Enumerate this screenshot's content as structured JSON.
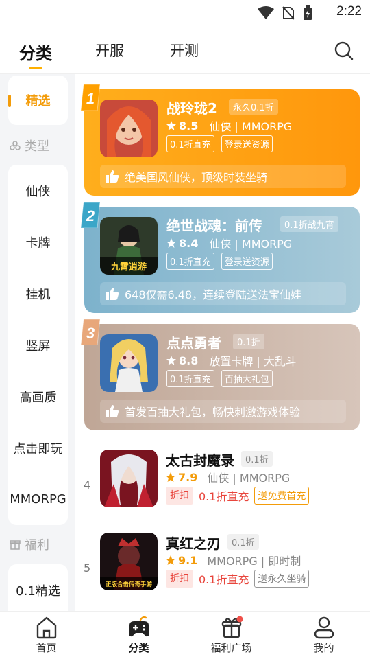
{
  "status_bar": {
    "time": "2:22"
  },
  "top_tabs": [
    "分类",
    "开服",
    "开测"
  ],
  "sidebar": {
    "selected": "精选",
    "type_header": "类型",
    "types": [
      "仙侠",
      "卡牌",
      "挂机",
      "竖屏",
      "高画质",
      "点击即玩",
      "MMORPG"
    ],
    "welfare_header": "福利",
    "welfare": [
      "0.1精选"
    ]
  },
  "featured": [
    {
      "rank": "1",
      "title": "战玲珑2",
      "tag": "永久0.1折",
      "score": "8.5",
      "genre": "仙侠 | MMORPG",
      "chips": [
        "0.1折直充",
        "登录送资源"
      ],
      "promo": "绝美国风仙侠，顶级时装坐骑",
      "color_from": "#ffb21a",
      "color_to": "#ff9a0e"
    },
    {
      "rank": "2",
      "title": "绝世战魂：前传",
      "tag": "0.1折战九宵",
      "score": "8.4",
      "genre": "仙侠 | MMORPG",
      "chips": [
        "0.1折直充",
        "登录送资源"
      ],
      "promo": "648仅需6.48，连续登陆送法宝仙娃",
      "thumb_text": "九霄逍游",
      "color_from": "#7fb4ce",
      "color_to": "#a6c8d8"
    },
    {
      "rank": "3",
      "title": "点点勇者",
      "tag": "0.1折",
      "score": "8.8",
      "genre": "放置卡牌 | 大乱斗",
      "chips": [
        "0.1折直充",
        "百抽大礼包"
      ],
      "promo": "首发百抽大礼包，畅快刺激游戏体验",
      "color_from": "#c0a898",
      "color_to": "#d6c3b8"
    }
  ],
  "list": [
    {
      "rank": "4",
      "title": "太古封魔录",
      "tag": "0.1折",
      "score": "7.9",
      "genre": "仙侠 | MMORPG",
      "discount_label": "折扣",
      "discount_text": "0.1折直充",
      "gift": "送免费首充",
      "gift_color": "#f39c0a"
    },
    {
      "rank": "5",
      "title": "真红之刃",
      "tag": "0.1折",
      "score": "9.1",
      "genre": "MMORPG | 即时制",
      "discount_label": "折扣",
      "discount_text": "0.1折直充",
      "gift": "送永久坐骑",
      "gift_color": "#888888",
      "thumb_text": "正版合击传奇手游"
    }
  ],
  "bottom_nav": [
    "首页",
    "分类",
    "福利广场",
    "我的"
  ],
  "colors": {
    "accent": "#f39c0a",
    "discount": "#e8453c"
  }
}
